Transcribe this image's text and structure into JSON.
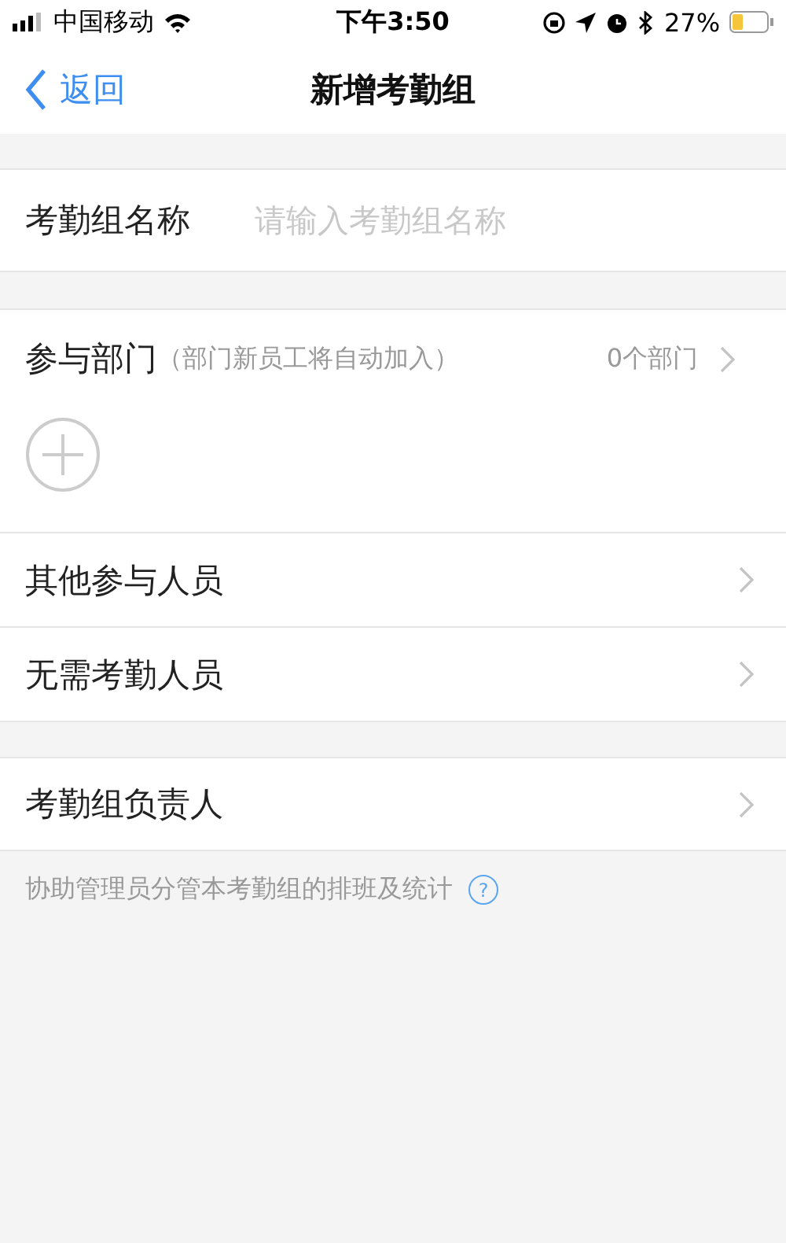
{
  "status_bar": {
    "carrier": "中国移动",
    "time": "下午3:50",
    "battery": "27%"
  },
  "nav": {
    "back": "返回",
    "title": "新增考勤组"
  },
  "name_field": {
    "label": "考勤组名称",
    "placeholder": "请输入考勤组名称"
  },
  "department": {
    "label": "参与部门",
    "note": "（部门新员工将自动加入）",
    "count": "0个部门"
  },
  "rows": [
    {
      "label": "其他参与人员"
    },
    {
      "label": "无需考勤人员"
    }
  ],
  "manager": {
    "label": "考勤组负责人"
  },
  "hint": {
    "text": "协助管理员分管本考勤组的排班及统计",
    "icon": "?"
  }
}
